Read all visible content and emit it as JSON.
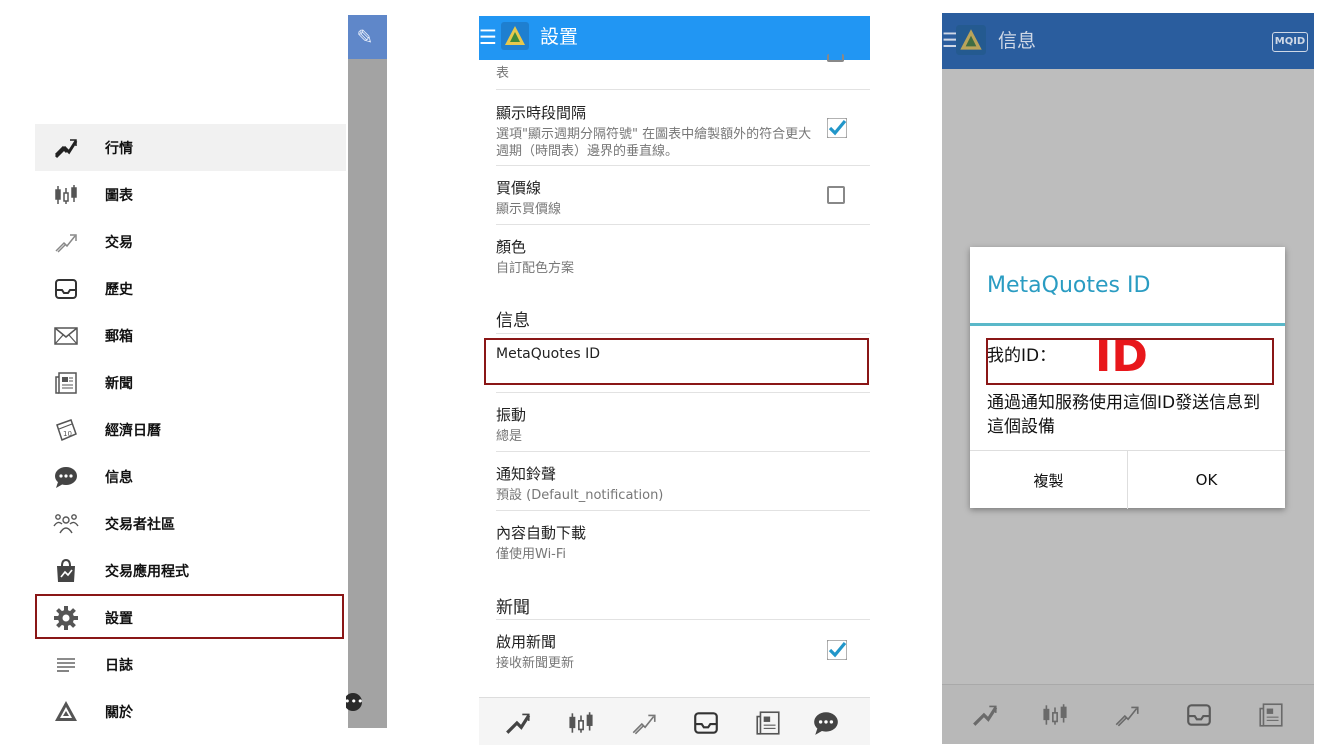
{
  "drawer": {
    "items": [
      {
        "label": "行情",
        "icon": "quotes-icon"
      },
      {
        "label": "圖表",
        "icon": "candlestick-chart-icon"
      },
      {
        "label": "交易",
        "icon": "trade-icon"
      },
      {
        "label": "歷史",
        "icon": "history-inbox-icon"
      },
      {
        "label": "郵箱",
        "icon": "mail-icon"
      },
      {
        "label": "新聞",
        "icon": "news-icon"
      },
      {
        "label": "經濟日曆",
        "icon": "economic-calendar-icon"
      },
      {
        "label": "信息",
        "icon": "chat-bubble-icon"
      },
      {
        "label": "交易者社區",
        "icon": "community-icon"
      },
      {
        "label": "交易應用程式",
        "icon": "app-store-bag-icon"
      },
      {
        "label": "設置",
        "icon": "gear-icon"
      },
      {
        "label": "日誌",
        "icon": "journal-icon"
      },
      {
        "label": "關於",
        "icon": "about-logo-icon"
      }
    ]
  },
  "settings": {
    "header_title": "設置",
    "partial_top": "表",
    "rows": [
      {
        "title": "顯示時段間隔",
        "sub": "選項\"顯示週期分隔符號\" 在圖表中繪製額外的符合更大週期（時間表）邊界的垂直線。"
      },
      {
        "title": "買價線",
        "sub": "顯示買價線"
      },
      {
        "title": "顏色",
        "sub": "自訂配色方案"
      },
      {
        "title": "MetaQuotes ID",
        "sub": ""
      },
      {
        "title": "振動",
        "sub": "總是"
      },
      {
        "title": "通知鈴聲",
        "sub": "預設 (Default_notification)"
      },
      {
        "title": "內容自動下載",
        "sub": "僅使用Wi-Fi"
      },
      {
        "title": "啟用新聞",
        "sub": "接收新聞更新"
      }
    ],
    "categories": {
      "messages": "信息",
      "news": "新聞"
    }
  },
  "messages_screen": {
    "header_title": "信息",
    "mqid_badge": "MQID"
  },
  "dialog": {
    "title": "MetaQuotes ID",
    "my_id_label": "我的ID：",
    "id_value": "ID",
    "message": "通過通知服務使用這個ID發送信息到這個設備",
    "copy_button": "複製",
    "ok_button": "OK"
  },
  "colors": {
    "settings_header": "#2196f3",
    "highlight_border": "#8a1616",
    "dialog_title": "#2a9cc2",
    "id_value": "#e8171b"
  }
}
